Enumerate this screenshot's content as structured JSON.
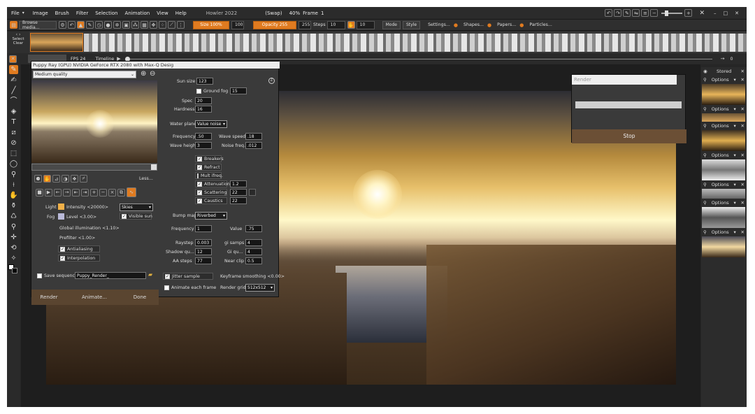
{
  "menu": {
    "items": [
      "File",
      "Image",
      "Brush",
      "Filter",
      "Selection",
      "Animation",
      "View",
      "Help"
    ],
    "title": "Howler 2022",
    "swap": "(Swap)",
    "zoom": "40%",
    "frame": "Frame",
    "frame_no": "1"
  },
  "toolbar": {
    "browse": "Browse media...",
    "size": "Size 100%",
    "size_val": "100",
    "opacity": "Opacity 255",
    "opacity_val": "255",
    "steps": "Steps",
    "steps_val": "10",
    "count_val": "10",
    "mode": "Mode",
    "style": "Style",
    "settings": "Settings...",
    "shapes": "Shapes...",
    "papers": "Papers...",
    "particles": "Particles..."
  },
  "strip": {
    "select": "Select",
    "clear": "Clear",
    "fps": "FPS 24",
    "timeline": "Timeline",
    "counter": "0"
  },
  "panel": {
    "title": "Puppy Ray (GPU)  NVIDIA GeForce RTX 2080 with Max-Q Desig",
    "quality": "Medium quality",
    "less": "Less...",
    "light": "Light",
    "intensity": "Intensity <20000>",
    "skies": "Skies",
    "fog": "Fog",
    "level": "Level <3.00>",
    "visible_sun": "Visible sun",
    "gi": "Global illumination <1.10>",
    "prefilter": "Prefilter <1.00>",
    "antialiasing": "Antialiasing",
    "interpolation": "Interpolation",
    "save_sequence": "Save sequence",
    "seq_name": "Puppy_Render_",
    "render": "Render",
    "animate": "Animate...",
    "done": "Done",
    "sun_size": "Sun size",
    "sun_size_val": "123",
    "ground_fog": "Ground fog",
    "ground_fog_val": "15",
    "spec": "Spec",
    "spec_val": "20",
    "hardness": "Hardness",
    "hardness_val": "16",
    "water_plane": "Water plane",
    "water_plane_val": "Value noise",
    "frequency": "Frequency",
    "frequency_val": ".50",
    "wave_speed": "Wave speed",
    "wave_speed_val": ".18",
    "wave_height": "Wave height",
    "wave_height_val": "3",
    "noise_freq": "Noise freq.",
    "noise_freq_val": ".012",
    "breakers": "Breakers",
    "refract": "Refract",
    "mult_ifreq": "Mult ifreq.",
    "attenuation": "Attenuation",
    "attenuation_val": "1.2",
    "scattering": "Scattering",
    "scattering_val": "22",
    "caustics": "Caustics",
    "caustics_val": "22",
    "bump_map": "Bump map",
    "bump_map_val": "Riverbed",
    "freq2": "Frequency",
    "freq2_val": "1",
    "value": "Value",
    "value_val": ".75",
    "raystep": "Raystep",
    "raystep_val": "0.003",
    "gi_samps": "gi samps",
    "gi_samps_val": "4",
    "shadow_qu": "Shadow qu...",
    "shadow_qu_val": "12",
    "gi_qu": "Gi qu...",
    "gi_qu_val": "4",
    "aa_steps": "AA steps",
    "aa_steps_val": "77",
    "near_clip": "Near clip",
    "near_clip_val": "0.5",
    "jitter": "Jitter sample",
    "keyframe": "Keyframe smoothing <0.00>",
    "animate_each": "Animate each frame",
    "render_grid": "Render grid",
    "render_grid_val": "512x512"
  },
  "render_dialog": {
    "title": "Render",
    "stop": "Stop"
  },
  "right": {
    "stored": "Stored",
    "options": "Options"
  },
  "colors": {
    "accent": "#e07b20",
    "panel": "#3a3a3a"
  }
}
